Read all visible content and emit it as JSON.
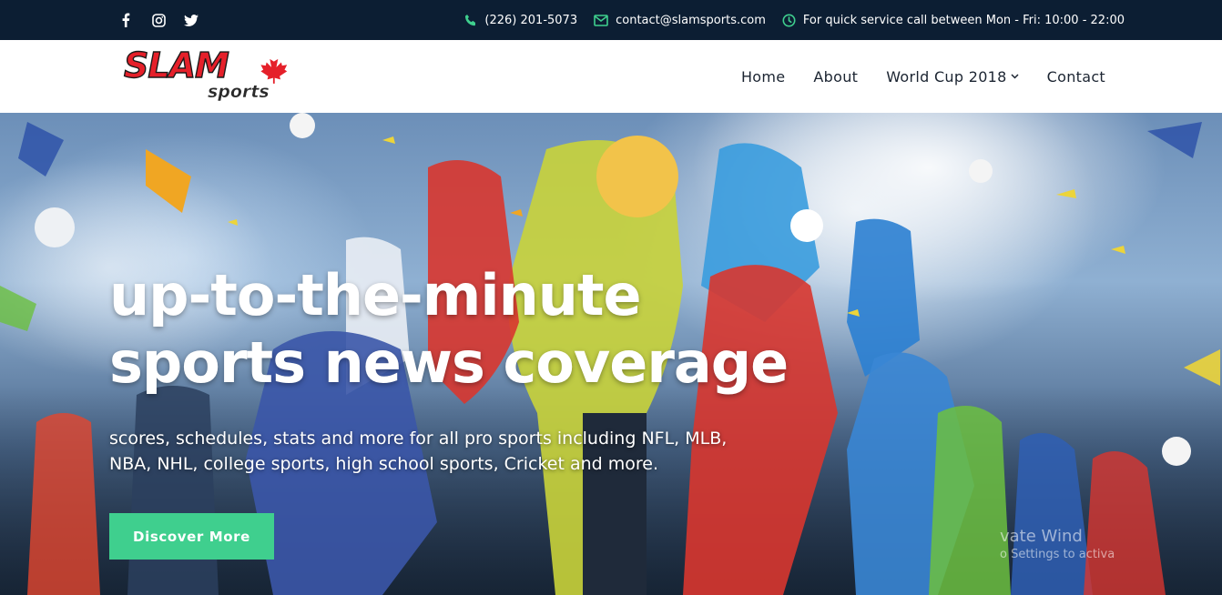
{
  "topbar": {
    "social": [
      {
        "icon": "facebook-icon"
      },
      {
        "icon": "instagram-icon"
      },
      {
        "icon": "twitter-icon"
      }
    ],
    "phone": "(226) 201-5073",
    "email": "contact@slamsports.com",
    "hours": "For quick service call between Mon - Fri: 10:00 - 22:00",
    "icon_color": "#3fcf8e"
  },
  "header": {
    "logo": {
      "line1": "SLAM",
      "line2": "sports"
    },
    "nav": [
      {
        "label": "Home"
      },
      {
        "label": "About"
      },
      {
        "label": "World Cup 2018"
      },
      {
        "label": "Contact"
      }
    ]
  },
  "hero": {
    "title_line1": "up-to-the-minute",
    "title_line2": "sports news coverage",
    "subtitle": "scores, schedules, stats and more for all pro sports including NFL, MLB, NBA, NHL, college sports, high school sports, Cricket and more.",
    "cta_label": "Discover More",
    "accent_color": "#3fcf8e"
  },
  "os_watermark": {
    "line1": "vate Wind",
    "line2": "o Settings to activa"
  }
}
